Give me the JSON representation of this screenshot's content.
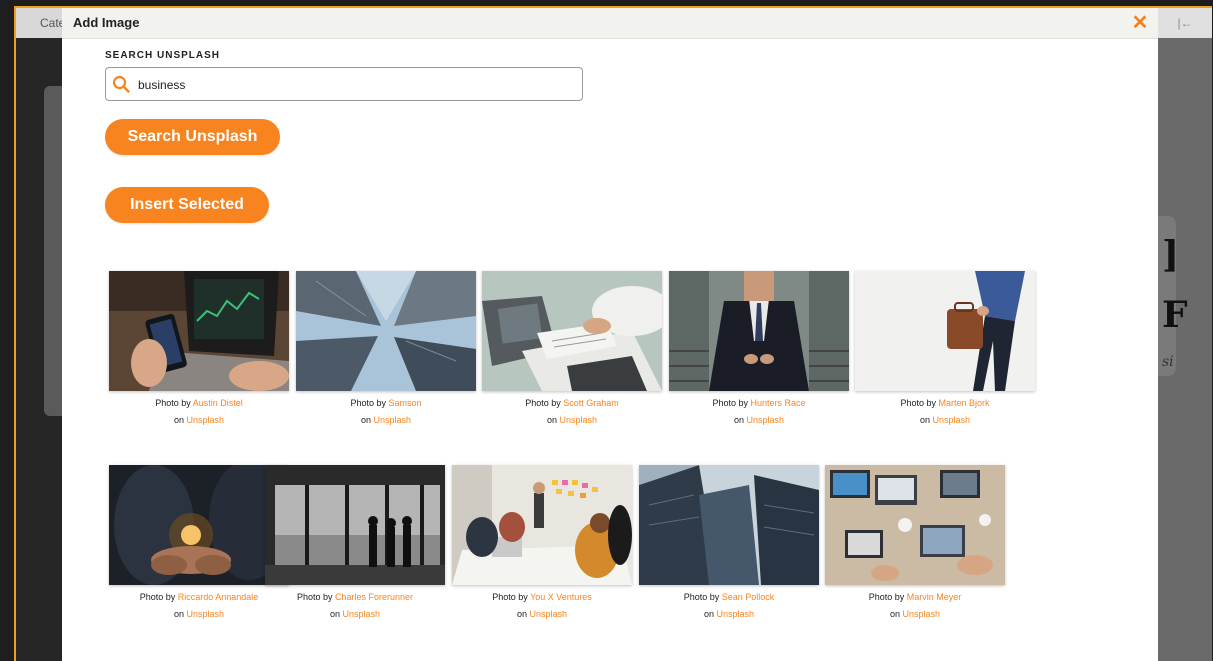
{
  "background": {
    "tab_label": "Cate",
    "right_icon": "|←"
  },
  "modal": {
    "title": "Add Image",
    "close_icon": "✕",
    "search_label": "SEARCH UNSPLASH",
    "search_value": "business",
    "search_button": "Search Unsplash",
    "insert_button": "Insert Selected",
    "photo_prefix": "Photo by",
    "on_prefix": "on",
    "source": "Unsplash"
  },
  "photos": [
    {
      "author": "Austin Distel"
    },
    {
      "author": "Samson"
    },
    {
      "author": "Scott Graham"
    },
    {
      "author": "Hunters Race"
    },
    {
      "author": "Marten Bjork"
    },
    {
      "author": "Riccardo Annandale"
    },
    {
      "author": "Charles Forerunner"
    },
    {
      "author": "You X Ventures"
    },
    {
      "author": "Sean Pollock"
    },
    {
      "author": "Marvin Meyer"
    }
  ],
  "colors": {
    "accent": "#f7841e",
    "modal_header": "#f2f2ef",
    "frame_border": "#f0a020"
  }
}
